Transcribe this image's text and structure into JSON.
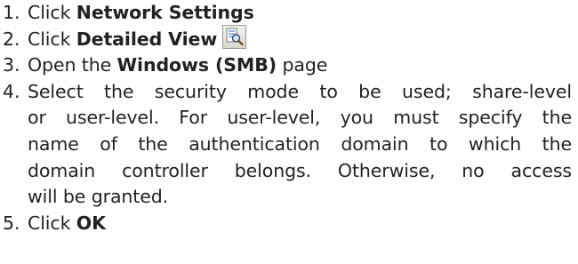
{
  "steps": [
    {
      "number": "1.",
      "text_before": "Click ",
      "bold": "Network Settings"
    },
    {
      "number": "2.",
      "text_before": "Click ",
      "bold": "Detailed View",
      "icon": "detailed-view-icon"
    },
    {
      "number": "3.",
      "text_before": "Open the ",
      "bold": "Windows (SMB)",
      "text_after": " page"
    },
    {
      "number": "4.",
      "lines": [
        "Select the security mode  to  be  used;  share-level",
        "or user-level.  For user-level, you must specify  the",
        "name  of the  authentication domain to which the",
        "domain controller belongs. Otherwise, no access",
        "will be granted."
      ]
    },
    {
      "number": "5.",
      "text_before": "Click ",
      "bold": "OK"
    }
  ]
}
